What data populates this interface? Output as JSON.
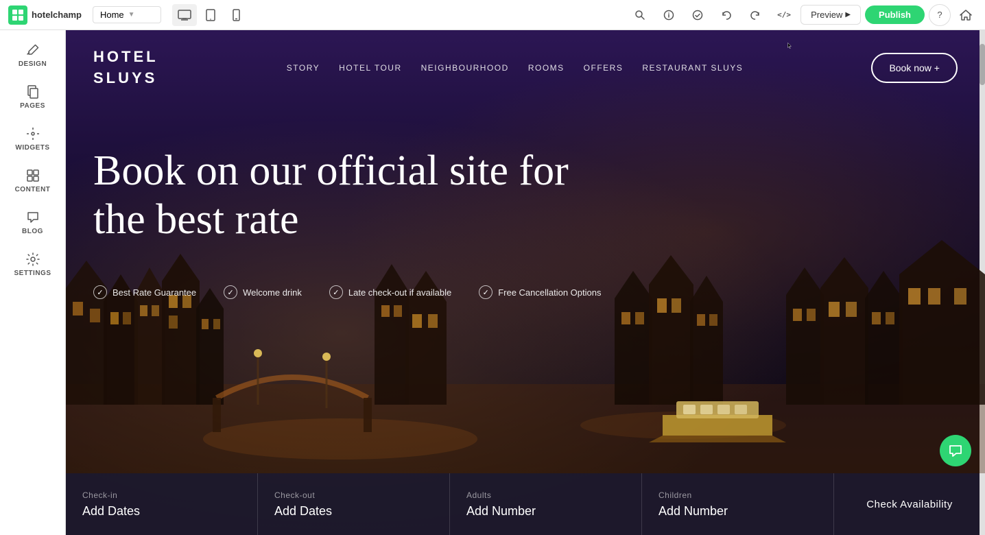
{
  "toolbar": {
    "logo_letter": "H",
    "logo_text": "hotelchamp",
    "page_label": "Home",
    "devices": [
      {
        "name": "desktop",
        "icon": "🖥",
        "active": true
      },
      {
        "name": "tablet",
        "icon": "⬜",
        "active": false
      },
      {
        "name": "mobile",
        "icon": "📱",
        "active": false
      }
    ],
    "search_icon": "🔍",
    "info_icon": "ℹ",
    "check_icon": "✓",
    "undo_icon": "↩",
    "redo_icon": "↪",
    "code_icon": "</>",
    "preview_label": "Preview",
    "publish_label": "Publish",
    "help_icon": "?",
    "home_icon": "⌂"
  },
  "sidebar": {
    "items": [
      {
        "id": "design",
        "label": "DESIGN",
        "icon": "✏️"
      },
      {
        "id": "pages",
        "label": "PAGES",
        "icon": "📄"
      },
      {
        "id": "widgets",
        "label": "WIDGETS",
        "icon": "➕"
      },
      {
        "id": "content",
        "label": "CONTENT",
        "icon": "📁"
      },
      {
        "id": "blog",
        "label": "BLOG",
        "icon": "💬"
      },
      {
        "id": "settings",
        "label": "SETTINGS",
        "icon": "⚙️"
      }
    ]
  },
  "hotel": {
    "logo_line1": "HOTEL",
    "logo_line2": "SLUYS",
    "nav_links": [
      {
        "label": "STORY"
      },
      {
        "label": "HOTEL TOUR"
      },
      {
        "label": "NEIGHBOURHOOD"
      },
      {
        "label": "ROOMS"
      },
      {
        "label": "OFFERS"
      },
      {
        "label": "RESTAURANT SLUYS"
      }
    ],
    "book_btn_label": "Book now +",
    "hero_title": "Book on our official site for the  best rate",
    "perks": [
      {
        "text": "Best Rate Guarantee"
      },
      {
        "text": "Welcome drink"
      },
      {
        "text": "Late check-out if available"
      },
      {
        "text": "Free Cancellation Options"
      }
    ],
    "booking": {
      "checkin_label": "Check-in",
      "checkin_value": "Add Dates",
      "checkout_label": "Check-out",
      "checkout_value": "Add Dates",
      "adults_label": "Adults",
      "adults_value": "Add Number",
      "children_label": "Children",
      "children_value": "Add Number",
      "check_availability_label": "Check Availability"
    }
  }
}
